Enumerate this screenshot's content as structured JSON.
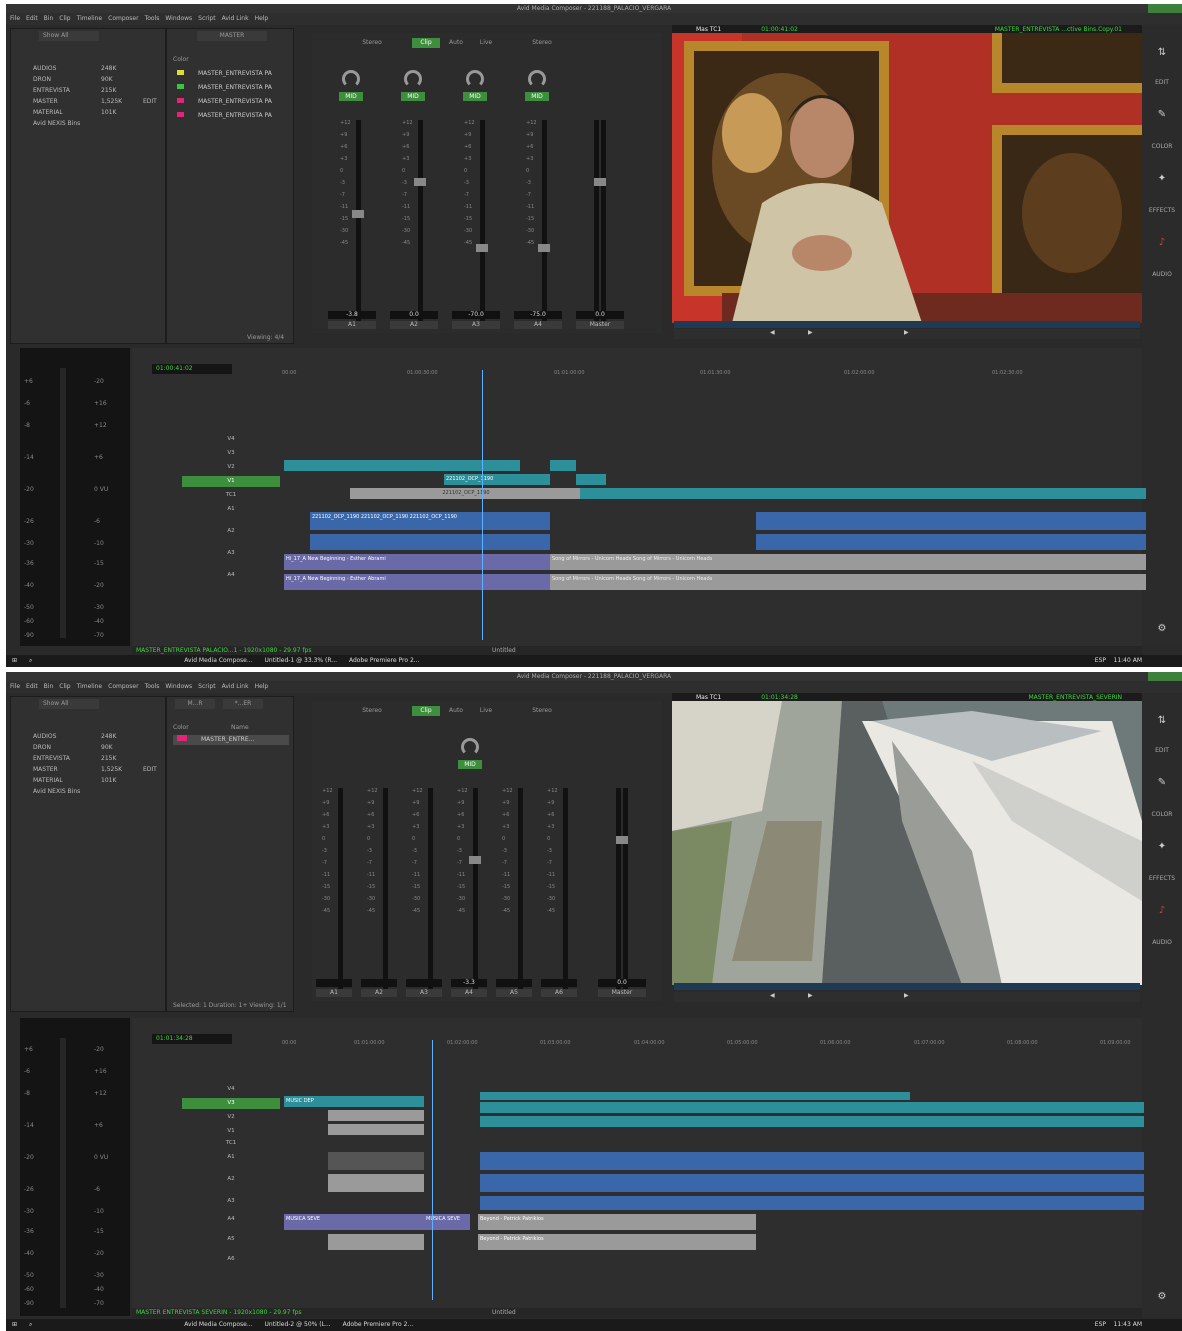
{
  "window_title": "Avid Media Composer - 221188_PALACIO_VERGARA",
  "menu": [
    "File",
    "Edit",
    "Bin",
    "Clip",
    "Timeline",
    "Composer",
    "Tools",
    "Windows",
    "Script",
    "Avid Link",
    "Help"
  ],
  "sidebar": [
    "EDIT",
    "COLOR",
    "EFFECTS",
    "AUDIO"
  ],
  "bins": {
    "show_all": "Show All",
    "items": [
      {
        "name": "AUDIOS",
        "size": "248K"
      },
      {
        "name": "DRON",
        "size": "90K"
      },
      {
        "name": "ENTREVISTA",
        "size": "215K"
      },
      {
        "name": "MASTER",
        "size": "1,525K",
        "extra": "EDIT"
      },
      {
        "name": "MATERIAL",
        "size": "101K"
      },
      {
        "name": "Avid NEXIS Bins",
        "size": ""
      }
    ]
  },
  "shot1": {
    "bin_tab": "MASTER",
    "bin_col": "Color",
    "bin_rows": [
      "MASTER_ENTREVISTA PA",
      "MASTER_ENTREVISTA PA",
      "MASTER_ENTREVISTA PA",
      "MASTER_ENTREVISTA PA"
    ],
    "bin_status": "Viewing: 4/4",
    "mixer_tabs": [
      "Stereo",
      "Clip",
      "Auto",
      "Live",
      "Stereo"
    ],
    "channels": [
      {
        "name": "A1",
        "val": "-3.8"
      },
      {
        "name": "A2",
        "val": "0.0"
      },
      {
        "name": "A3",
        "val": "-70.0"
      },
      {
        "name": "A4",
        "val": "-75.0"
      },
      {
        "name": "Master",
        "val": "0.0"
      }
    ],
    "monitor_label": "Mas  TC1",
    "monitor_tc": "01:00:41:02",
    "monitor_clip": "MASTER_ENTREVISTA ...ctive Bins.Copy.01",
    "timecode": "01:00:41:02",
    "ruler": [
      "00:00",
      "01:00:30:00",
      "01:01:00:00",
      "01:01:30:00",
      "01:02:00:00",
      "01:02:30:00"
    ],
    "tracks": [
      "V4",
      "V3",
      "V2",
      "V1",
      "TC1",
      "A1",
      "A2",
      "A3",
      "A4"
    ],
    "clips": {
      "v2a": "221102_OCP_1190",
      "v1a": "221102_OCP_1190",
      "a1": "221102_OCP_1190  221102_OCP_1190  221102_OCP_1190",
      "a3": "Hi_17_A New Beginning - Esther Abrami",
      "a3b": "Song of Mirrors - Unicorn Heads   Song of Mirrors - Unicorn Heads",
      "a4": "Hi_17_A New Beginning - Esther Abrami",
      "a4b": "Song of Mirrors - Unicorn Heads   Song of Mirrors - Unicorn Heads"
    },
    "status": "MASTER_ENTREVISTA PALACIO...1 - 1920x1080 - 29.97 fps",
    "status_right": "Untitled",
    "taskbar": [
      "Avid Media Compose...",
      "Untitled-1 @ 33.3% (R...",
      "Adobe Premiere Pro 2..."
    ],
    "clock": "11:40 AM",
    "lang": "ESP"
  },
  "shot2": {
    "bin_tab": "M...R",
    "bin_tab2": "*...ER",
    "bin_cols": [
      "Color",
      "Name"
    ],
    "bin_rows": [
      "MASTER_ENTRE..."
    ],
    "bin_status": "Selected: 1 Duration: 1+ Viewing: 1/1",
    "mixer_tabs": [
      "Stereo",
      "Clip",
      "Auto",
      "Live",
      "Stereo"
    ],
    "channels": [
      {
        "name": "A1",
        "val": ""
      },
      {
        "name": "A2",
        "val": ""
      },
      {
        "name": "A3",
        "val": ""
      },
      {
        "name": "A4",
        "val": "-3.3"
      },
      {
        "name": "A5",
        "val": ""
      },
      {
        "name": "A6",
        "val": ""
      },
      {
        "name": "Master",
        "val": "0.0"
      }
    ],
    "monitor_label": "Mas  TC1",
    "monitor_tc": "01:01:34:28",
    "monitor_clip": "MASTER_ENTREVISTA_SEVERIN",
    "timecode": "01:01:34:28",
    "ruler": [
      "00:00",
      "01:01:00:00",
      "01:02:00:00",
      "01:03:00:00",
      "01:04:00:00",
      "01:05:00:00",
      "01:06:00:00",
      "01:07:00:00",
      "01:08:00:00",
      "01:09:00:00"
    ],
    "tracks": [
      "V4",
      "V3",
      "V2",
      "V1",
      "TC1",
      "A1",
      "A2",
      "A3",
      "A4",
      "A5",
      "A6"
    ],
    "clips": {
      "v3a": "MUSIC DEP",
      "a4": "MUSICA SEVE",
      "a4b": "MUSICA SEVE",
      "a4c": "Beyond - Patrick Patrikios",
      "a5": "Beyond - Patrick Patrikios"
    },
    "status": "MASTER ENTREVISTA SEVERIN - 1920x1080 - 29.97 fps",
    "status_right": "Untitled",
    "taskbar": [
      "Avid Media Compose...",
      "Untitled-2 @ 50% (L...",
      "Adobe Premiere Pro 2..."
    ],
    "clock": "11:43 AM",
    "lang": "ESP"
  },
  "meter_left": [
    "+6",
    "-6",
    "-8",
    "-14",
    "-20",
    "-26",
    "-30",
    "-36",
    "-40",
    "-50",
    "-60",
    "-90"
  ],
  "meter_right": [
    "-20",
    "+16",
    "+12",
    "+6",
    "0 VU",
    "-6",
    "-10",
    "-15",
    "-20",
    "-30",
    "-40",
    "-70"
  ],
  "colors": {
    "accent": "#3d8f3d",
    "video_clip": "#2c8f99",
    "audio_clip": "#3a66aa",
    "timecode": "#3fd83f"
  }
}
